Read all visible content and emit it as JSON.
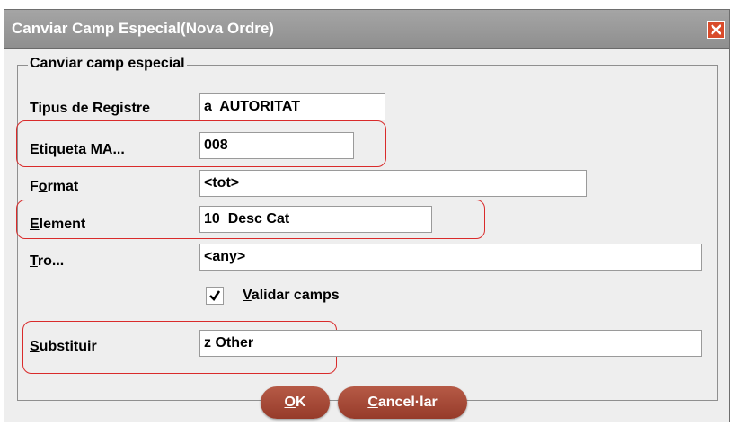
{
  "window": {
    "title": "Canviar Camp Especial(Nova Ordre)"
  },
  "group": {
    "legend": "Canviar camp especial"
  },
  "fields": {
    "tipus": {
      "label_pre": "Tipus de Registre",
      "value": "a  AUTORITAT"
    },
    "etiqueta": {
      "label_pre": "Etiqueta ",
      "label_u": "MA",
      "label_post": "...",
      "value": "008"
    },
    "format": {
      "label_pre": "F",
      "label_u": "o",
      "label_post": "rmat",
      "value": "<tot>"
    },
    "element": {
      "label_u": "E",
      "label_post": "lement",
      "value": "10  Desc Cat"
    },
    "tro": {
      "label_u": "T",
      "label_post": "ro...",
      "value": "<any>"
    },
    "validar": {
      "label_u": "V",
      "label_post": "alidar camps",
      "checked": true
    },
    "substituir": {
      "label_u": "S",
      "label_post": "ubstituir",
      "value": "z Other"
    }
  },
  "buttons": {
    "ok": {
      "label_u": "O",
      "label_post": "K"
    },
    "cancel": {
      "label_u": "C",
      "label_post": "ancel·lar"
    }
  },
  "colors": {
    "titlebar": "#9b9b9b",
    "close": "#d94b2a",
    "highlight": "#d92b2b",
    "button": "#a84a37"
  }
}
